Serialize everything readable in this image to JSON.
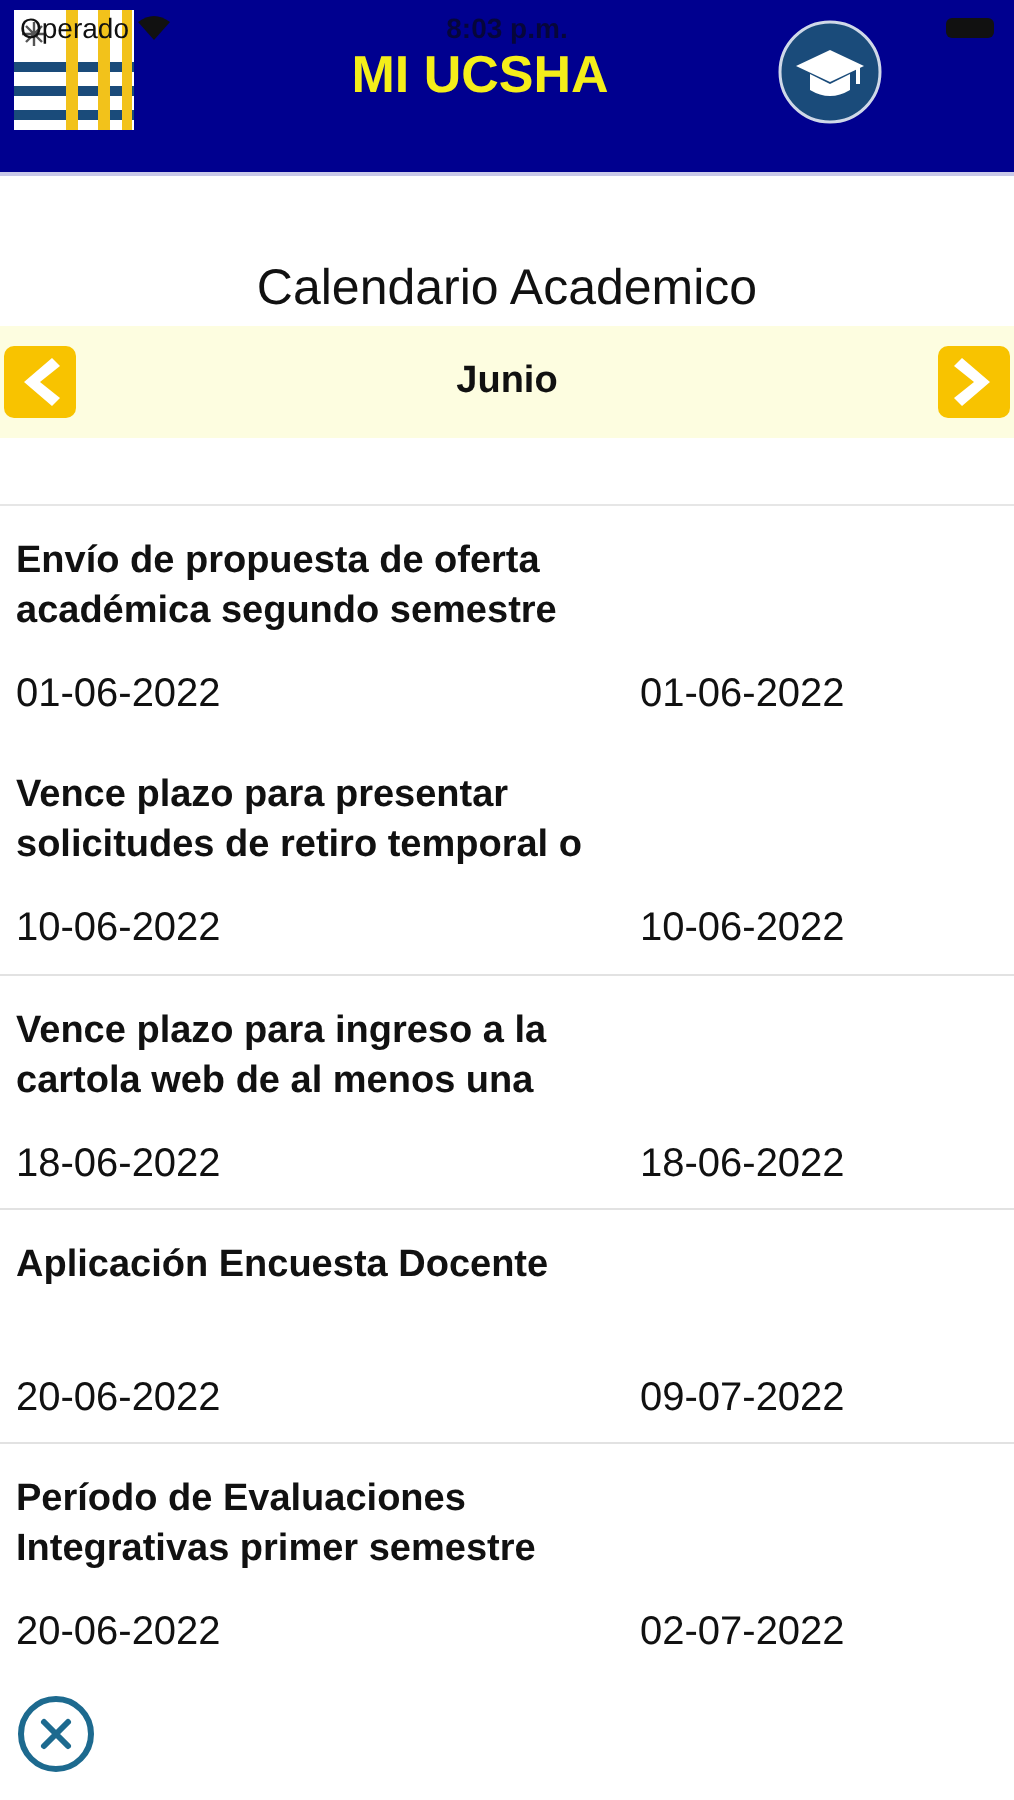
{
  "status_bar": {
    "carrier": "Operado",
    "time": "8:03 p.m."
  },
  "header": {
    "title": "MI UCSHA"
  },
  "page_title": "Calendario Academico",
  "month_bar": {
    "month": "Junio"
  },
  "events": [
    {
      "title": "Envío de propuesta de oferta académica segundo semestre",
      "start": "01-06-2022",
      "end": "01-06-2022"
    },
    {
      "title": "Vence plazo para presentar solicitudes de retiro temporal o",
      "start": "10-06-2022",
      "end": "10-06-2022"
    },
    {
      "title": "Vence plazo para ingreso a la cartola web de al menos una",
      "start": "18-06-2022",
      "end": "18-06-2022"
    },
    {
      "title": "Aplicación Encuesta Docente",
      "start": "20-06-2022",
      "end": "09-07-2022"
    },
    {
      "title": "Período de Evaluaciones Integrativas primer semestre",
      "start": "20-06-2022",
      "end": "02-07-2022"
    }
  ]
}
